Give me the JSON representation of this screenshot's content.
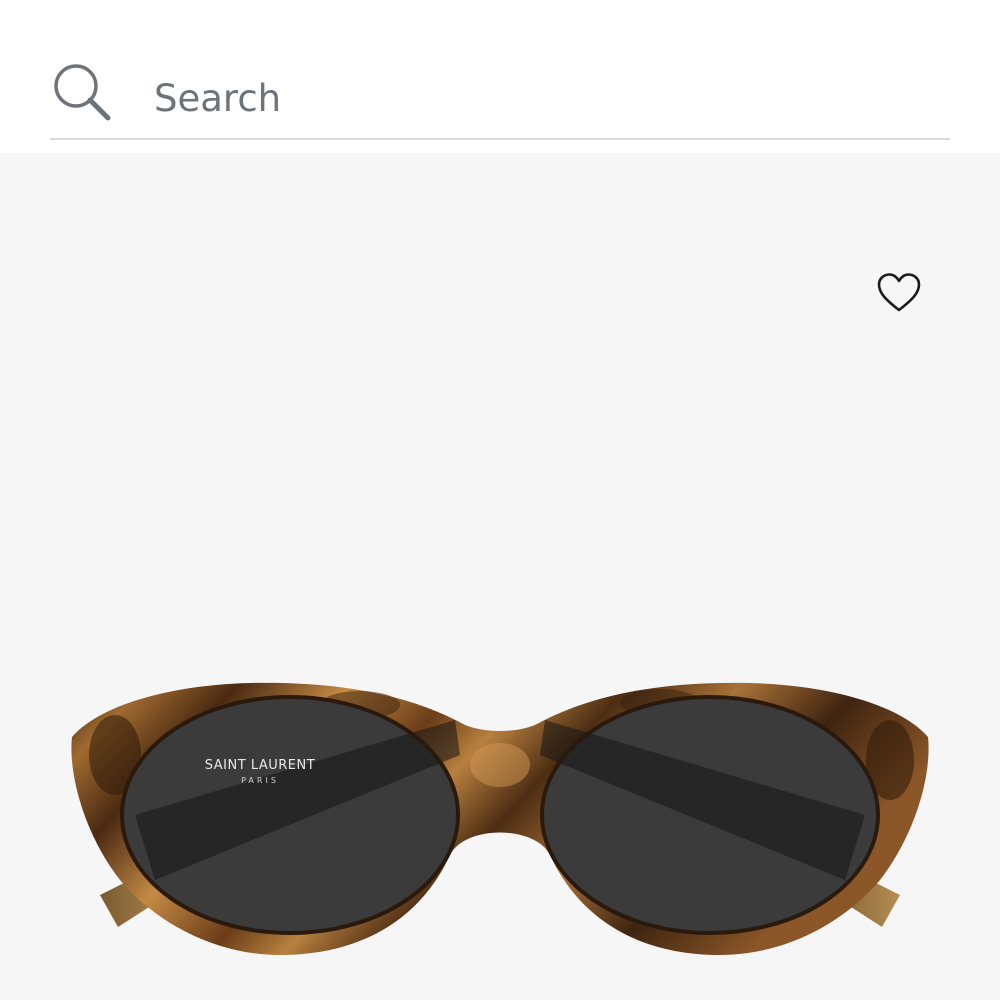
{
  "search": {
    "placeholder": "Search",
    "value": ""
  },
  "product": {
    "brand_logo_line1": "SAINT LAURENT",
    "brand_logo_line2": "PARIS",
    "wishlist_icon": "heart-outline-icon",
    "image_subject": "tortoiseshell cat-eye sunglasses"
  },
  "colors": {
    "background": "#ffffff",
    "product_background": "#f6f6f6",
    "divider": "#d9d9d9",
    "icon": "#6e7379",
    "frame_dark": "#3a2210",
    "frame_light": "#b5803e",
    "lens": "#3b3b3b"
  }
}
